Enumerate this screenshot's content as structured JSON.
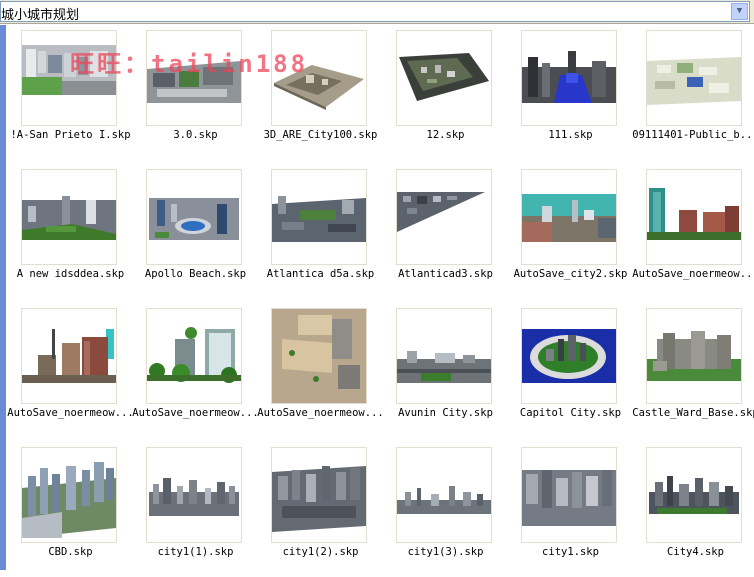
{
  "address_bar": {
    "path": "城小城市规划"
  },
  "watermark": "旺旺：tailin188",
  "files": [
    {
      "name": "!A-San Prieto I.skp",
      "thumb": "campus"
    },
    {
      "name": "3.0.skp",
      "thumb": "gray-plan"
    },
    {
      "name": "3D_ARE_City100.skp",
      "thumb": "plan-perspective"
    },
    {
      "name": "12.skp",
      "thumb": "dark-grid"
    },
    {
      "name": "111.skp",
      "thumb": "dark-blue"
    },
    {
      "name": "09111401-Public_b...",
      "thumb": "light-plan"
    },
    {
      "name": "A new idsddea.skp",
      "thumb": "green-field"
    },
    {
      "name": "Apollo Beach.skp",
      "thumb": "stadium"
    },
    {
      "name": "Atlantica d5a.skp",
      "thumb": "wide-city"
    },
    {
      "name": "Atlanticad3.skp",
      "thumb": "diagonal"
    },
    {
      "name": "AutoSave_city2.skp",
      "thumb": "teal-sky"
    },
    {
      "name": "AutoSave_noermeow...",
      "thumb": "towers-red"
    },
    {
      "name": "AutoSave_noermeow...",
      "thumb": "street-red"
    },
    {
      "name": "AutoSave_noermeow...",
      "thumb": "trees-tower"
    },
    {
      "name": "AutoSave_noermeow...",
      "thumb": "sand-plan"
    },
    {
      "name": "Avunin City.skp",
      "thumb": "skyline-low"
    },
    {
      "name": "Capitol City.skp",
      "thumb": "blue-island"
    },
    {
      "name": "Castle_Ward_Base.skp",
      "thumb": "castle"
    },
    {
      "name": "CBD.skp",
      "thumb": "cbd"
    },
    {
      "name": "city1(1).skp",
      "thumb": "skyline"
    },
    {
      "name": "city1(2).skp",
      "thumb": "dense"
    },
    {
      "name": "city1(3).skp",
      "thumb": "skyline-thin"
    },
    {
      "name": "city1.skp",
      "thumb": "gray-block"
    },
    {
      "name": "City4.skp",
      "thumb": "skyline-dark"
    }
  ]
}
